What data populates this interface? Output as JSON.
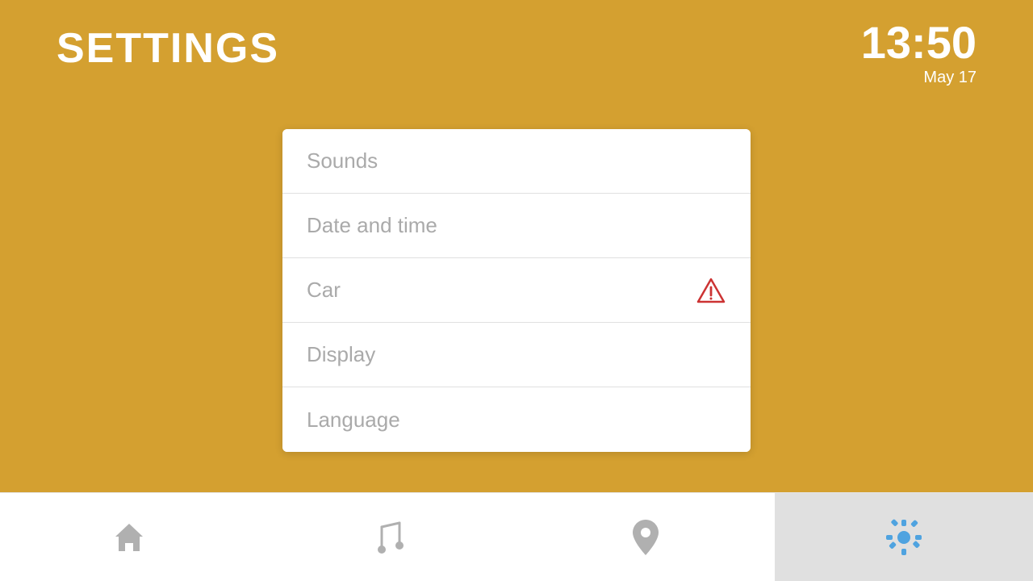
{
  "header": {
    "title": "SETTINGS",
    "clock": {
      "time": "13:50",
      "date": "May 17"
    }
  },
  "menu": {
    "items": [
      {
        "id": "sounds",
        "label": "Sounds",
        "warning": false
      },
      {
        "id": "date-and-time",
        "label": "Date and time",
        "warning": false
      },
      {
        "id": "car",
        "label": "Car",
        "warning": true
      },
      {
        "id": "display",
        "label": "Display",
        "warning": false
      },
      {
        "id": "language",
        "label": "Language",
        "warning": false
      }
    ]
  },
  "bottomNav": {
    "items": [
      {
        "id": "home",
        "icon": "home-icon",
        "active": false
      },
      {
        "id": "music",
        "icon": "music-icon",
        "active": false
      },
      {
        "id": "location",
        "icon": "location-icon",
        "active": false
      },
      {
        "id": "settings",
        "icon": "settings-icon",
        "active": true
      }
    ]
  },
  "colors": {
    "background": "#D4A030",
    "menuBg": "white",
    "textMuted": "#aaaaaa",
    "warning": "#cc3333",
    "navActive": "#e0e0e0",
    "settingsBlue": "#4fa3e0"
  }
}
